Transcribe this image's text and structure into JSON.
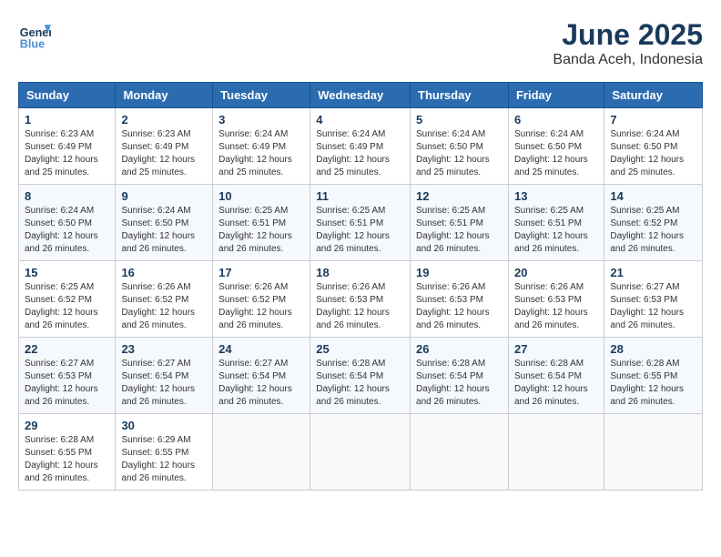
{
  "header": {
    "logo_line1": "General",
    "logo_line2": "Blue",
    "month": "June 2025",
    "location": "Banda Aceh, Indonesia"
  },
  "columns": [
    "Sunday",
    "Monday",
    "Tuesday",
    "Wednesday",
    "Thursday",
    "Friday",
    "Saturday"
  ],
  "weeks": [
    [
      {
        "day": "1",
        "info": "Sunrise: 6:23 AM\nSunset: 6:49 PM\nDaylight: 12 hours\nand 25 minutes."
      },
      {
        "day": "2",
        "info": "Sunrise: 6:23 AM\nSunset: 6:49 PM\nDaylight: 12 hours\nand 25 minutes."
      },
      {
        "day": "3",
        "info": "Sunrise: 6:24 AM\nSunset: 6:49 PM\nDaylight: 12 hours\nand 25 minutes."
      },
      {
        "day": "4",
        "info": "Sunrise: 6:24 AM\nSunset: 6:49 PM\nDaylight: 12 hours\nand 25 minutes."
      },
      {
        "day": "5",
        "info": "Sunrise: 6:24 AM\nSunset: 6:50 PM\nDaylight: 12 hours\nand 25 minutes."
      },
      {
        "day": "6",
        "info": "Sunrise: 6:24 AM\nSunset: 6:50 PM\nDaylight: 12 hours\nand 25 minutes."
      },
      {
        "day": "7",
        "info": "Sunrise: 6:24 AM\nSunset: 6:50 PM\nDaylight: 12 hours\nand 25 minutes."
      }
    ],
    [
      {
        "day": "8",
        "info": "Sunrise: 6:24 AM\nSunset: 6:50 PM\nDaylight: 12 hours\nand 26 minutes."
      },
      {
        "day": "9",
        "info": "Sunrise: 6:24 AM\nSunset: 6:50 PM\nDaylight: 12 hours\nand 26 minutes."
      },
      {
        "day": "10",
        "info": "Sunrise: 6:25 AM\nSunset: 6:51 PM\nDaylight: 12 hours\nand 26 minutes."
      },
      {
        "day": "11",
        "info": "Sunrise: 6:25 AM\nSunset: 6:51 PM\nDaylight: 12 hours\nand 26 minutes."
      },
      {
        "day": "12",
        "info": "Sunrise: 6:25 AM\nSunset: 6:51 PM\nDaylight: 12 hours\nand 26 minutes."
      },
      {
        "day": "13",
        "info": "Sunrise: 6:25 AM\nSunset: 6:51 PM\nDaylight: 12 hours\nand 26 minutes."
      },
      {
        "day": "14",
        "info": "Sunrise: 6:25 AM\nSunset: 6:52 PM\nDaylight: 12 hours\nand 26 minutes."
      }
    ],
    [
      {
        "day": "15",
        "info": "Sunrise: 6:25 AM\nSunset: 6:52 PM\nDaylight: 12 hours\nand 26 minutes."
      },
      {
        "day": "16",
        "info": "Sunrise: 6:26 AM\nSunset: 6:52 PM\nDaylight: 12 hours\nand 26 minutes."
      },
      {
        "day": "17",
        "info": "Sunrise: 6:26 AM\nSunset: 6:52 PM\nDaylight: 12 hours\nand 26 minutes."
      },
      {
        "day": "18",
        "info": "Sunrise: 6:26 AM\nSunset: 6:53 PM\nDaylight: 12 hours\nand 26 minutes."
      },
      {
        "day": "19",
        "info": "Sunrise: 6:26 AM\nSunset: 6:53 PM\nDaylight: 12 hours\nand 26 minutes."
      },
      {
        "day": "20",
        "info": "Sunrise: 6:26 AM\nSunset: 6:53 PM\nDaylight: 12 hours\nand 26 minutes."
      },
      {
        "day": "21",
        "info": "Sunrise: 6:27 AM\nSunset: 6:53 PM\nDaylight: 12 hours\nand 26 minutes."
      }
    ],
    [
      {
        "day": "22",
        "info": "Sunrise: 6:27 AM\nSunset: 6:53 PM\nDaylight: 12 hours\nand 26 minutes."
      },
      {
        "day": "23",
        "info": "Sunrise: 6:27 AM\nSunset: 6:54 PM\nDaylight: 12 hours\nand 26 minutes."
      },
      {
        "day": "24",
        "info": "Sunrise: 6:27 AM\nSunset: 6:54 PM\nDaylight: 12 hours\nand 26 minutes."
      },
      {
        "day": "25",
        "info": "Sunrise: 6:28 AM\nSunset: 6:54 PM\nDaylight: 12 hours\nand 26 minutes."
      },
      {
        "day": "26",
        "info": "Sunrise: 6:28 AM\nSunset: 6:54 PM\nDaylight: 12 hours\nand 26 minutes."
      },
      {
        "day": "27",
        "info": "Sunrise: 6:28 AM\nSunset: 6:54 PM\nDaylight: 12 hours\nand 26 minutes."
      },
      {
        "day": "28",
        "info": "Sunrise: 6:28 AM\nSunset: 6:55 PM\nDaylight: 12 hours\nand 26 minutes."
      }
    ],
    [
      {
        "day": "29",
        "info": "Sunrise: 6:28 AM\nSunset: 6:55 PM\nDaylight: 12 hours\nand 26 minutes."
      },
      {
        "day": "30",
        "info": "Sunrise: 6:29 AM\nSunset: 6:55 PM\nDaylight: 12 hours\nand 26 minutes."
      },
      {
        "day": "",
        "info": ""
      },
      {
        "day": "",
        "info": ""
      },
      {
        "day": "",
        "info": ""
      },
      {
        "day": "",
        "info": ""
      },
      {
        "day": "",
        "info": ""
      }
    ]
  ]
}
